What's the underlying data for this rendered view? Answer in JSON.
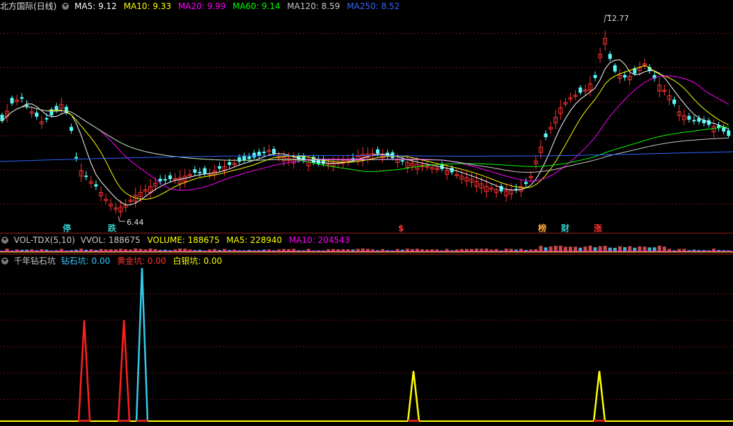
{
  "main": {
    "title": "北方国际(日线)",
    "ma": [
      {
        "label": "MA5: 9.12",
        "color": "#ffffff"
      },
      {
        "label": "MA10: 9.33",
        "color": "#ffff00"
      },
      {
        "label": "MA20: 9.99",
        "color": "#ff00ff"
      },
      {
        "label": "MA60: 9.14",
        "color": "#00ff00"
      },
      {
        "label": "MA120: 8.59",
        "color": "#c8c8c8"
      },
      {
        "label": "MA250: 8.52",
        "color": "#3366ff"
      }
    ],
    "high_label": "12.77",
    "low_label": "6.44",
    "signals": [
      {
        "text": "停",
        "color": "#33cccc"
      },
      {
        "text": "跌",
        "color": "#33cccc"
      },
      {
        "text": "$",
        "color": "#ff3333"
      },
      {
        "text": "榜",
        "color": "#ffaa33"
      },
      {
        "text": "财",
        "color": "#33cccc"
      },
      {
        "text": "涨",
        "color": "#ff3333"
      }
    ]
  },
  "vol": {
    "name": "VOL-TDX(5,10)",
    "items": [
      {
        "label": "VVOL: 188675",
        "color": "#c8c8c8"
      },
      {
        "label": "VOLUME: 188675",
        "color": "#ffff00"
      },
      {
        "label": "MA5: 228940",
        "color": "#ffff00"
      },
      {
        "label": "MA10: 204543",
        "color": "#ff00ff"
      }
    ]
  },
  "ind": {
    "name": "千年钻石坑",
    "items": [
      {
        "label": "钻石坑: 0.00",
        "color": "#33ccff"
      },
      {
        "label": "黄金坑: 0.00",
        "color": "#ff3333"
      },
      {
        "label": "白银坑: 0.00",
        "color": "#ffff00"
      }
    ]
  },
  "colors": {
    "up": "#ff3232",
    "down": "#54fcfc",
    "grid": "#7a1010"
  }
}
